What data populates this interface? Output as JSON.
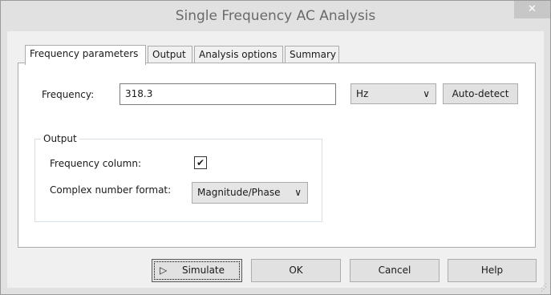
{
  "window": {
    "title": "Single Frequency AC Analysis",
    "close_glyph": "✕"
  },
  "tabs": [
    {
      "label": "Frequency parameters",
      "active": true
    },
    {
      "label": "Output",
      "active": false
    },
    {
      "label": "Analysis options",
      "active": false
    },
    {
      "label": "Summary",
      "active": false
    }
  ],
  "frequency": {
    "label": "Frequency:",
    "value": "318.3",
    "unit": "Hz",
    "unit_arrow": "∨",
    "auto_detect_label": "Auto-detect"
  },
  "output_group": {
    "title": "Output",
    "frequency_column_label": "Frequency column:",
    "frequency_column_checked": true,
    "check_glyph": "✔",
    "complex_format_label": "Complex number format:",
    "complex_format_value": "Magnitude/Phase",
    "complex_format_arrow": "∨"
  },
  "buttons": {
    "simulate_glyph": "▷",
    "simulate": "Simulate",
    "ok": "OK",
    "cancel": "Cancel",
    "help": "Help"
  },
  "colors": {
    "chrome": "#e1e1e1",
    "client": "#f0f0f0",
    "panel": "#ffffff",
    "close_button": "#c7c7c7"
  },
  "icons": [
    "close-icon",
    "checkmark-icon",
    "play-icon",
    "dropdown-arrow-icon",
    "resize-grip-icon"
  ]
}
